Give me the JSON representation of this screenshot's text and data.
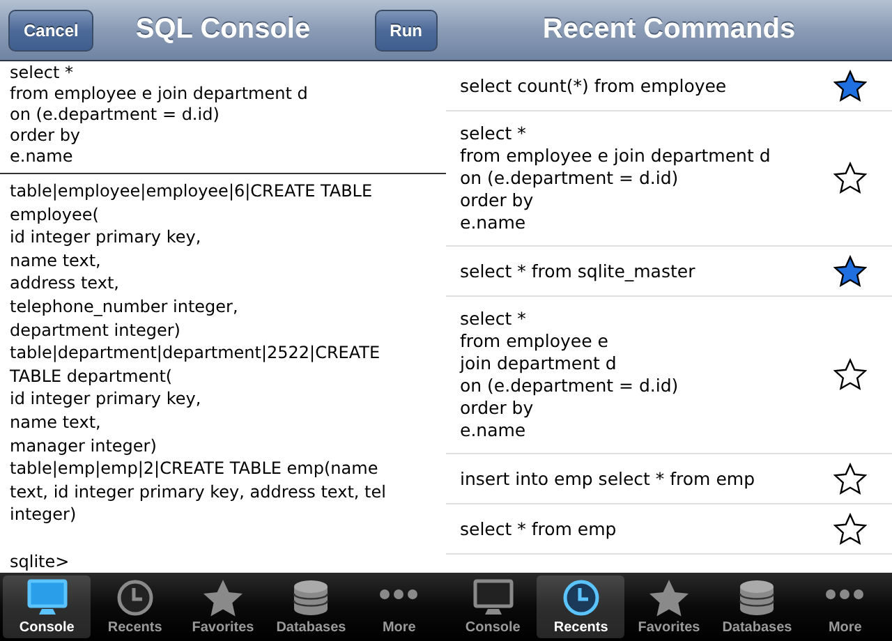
{
  "console": {
    "nav": {
      "cancel": "Cancel",
      "title": "SQL Console",
      "run": "Run"
    },
    "query": "select *\nfrom employee e join department d\non (e.department = d.id)\norder by\ne.name",
    "output": "table|employee|employee|6|CREATE TABLE\nemployee(\nid integer primary key,\nname text,\naddress text,\ntelephone_number integer,\ndepartment integer)\ntable|department|department|2522|CREATE\nTABLE department(\nid integer primary key,\nname text,\nmanager integer)\ntable|emp|emp|2|CREATE TABLE emp(name\ntext, id integer primary key, address text, tel\ninteger)\n\nsqlite>",
    "tabs": [
      {
        "label": "Console",
        "kind": "monitor",
        "selected": true
      },
      {
        "label": "Recents",
        "kind": "clock",
        "selected": false
      },
      {
        "label": "Favorites",
        "kind": "star",
        "selected": false
      },
      {
        "label": "Databases",
        "kind": "db",
        "selected": false
      },
      {
        "label": "More",
        "kind": "dots",
        "selected": false
      }
    ]
  },
  "recents": {
    "nav": {
      "title": "Recent Commands"
    },
    "commands": [
      {
        "text": "select count(*) from employee",
        "favorite": true
      },
      {
        "text": "select *\nfrom employee e join department d\non (e.department = d.id)\norder by\ne.name",
        "favorite": false
      },
      {
        "text": "select * from sqlite_master",
        "favorite": true
      },
      {
        "text": "select *\nfrom employee e\njoin department d\non (e.department = d.id)\norder by\ne.name",
        "favorite": false
      },
      {
        "text": "insert into emp select * from emp",
        "favorite": false
      },
      {
        "text": "select * from emp",
        "favorite": false
      }
    ],
    "tabs": [
      {
        "label": "Console",
        "kind": "monitor",
        "selected": false
      },
      {
        "label": "Recents",
        "kind": "clock",
        "selected": true
      },
      {
        "label": "Favorites",
        "kind": "star",
        "selected": false
      },
      {
        "label": "Databases",
        "kind": "db",
        "selected": false
      },
      {
        "label": "More",
        "kind": "dots",
        "selected": false
      }
    ]
  }
}
